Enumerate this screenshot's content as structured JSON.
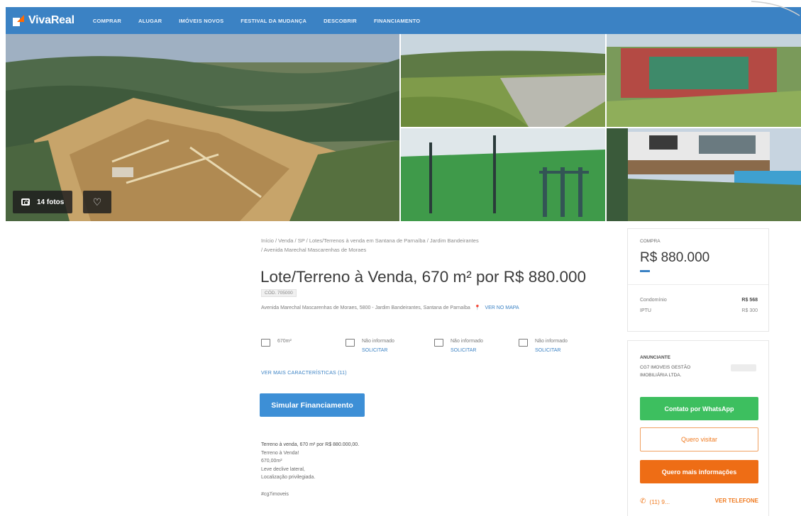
{
  "header": {
    "brand": "VivaReal",
    "nav": [
      "COMPRAR",
      "ALUGAR",
      "IMÓVEIS NOVOS",
      "FESTIVAL DA MUDANÇA",
      "DESCOBRIR",
      "FINANCIAMENTO"
    ]
  },
  "gallery": {
    "photos_label": "14 fotos",
    "camera_icon": "camera-icon",
    "favorite_icon": "heart-icon"
  },
  "listing": {
    "breadcrumb_line1": "Início / Venda / SP / Lotes/Terrenos à venda em Santana de Parnaíba / Jardim Bandeirantes",
    "breadcrumb_line2": "/ Avenida Marechal Mascarenhas de Moraes",
    "title": "Lote/Terreno à Venda, 670 m² por R$ 880.000",
    "code": "CÓD. 705000",
    "address": "Avenida Marechal Mascarenhas de Moraes, 5800 - Jardim Bandeirantes, Santana de Parnaíba",
    "map_link": "VER NO MAPA",
    "features": [
      {
        "icon": "area-icon",
        "label": "670m²",
        "request": ""
      },
      {
        "icon": "bed-icon",
        "label": "Não informado",
        "request": "SOLICITAR"
      },
      {
        "icon": "bath-icon",
        "label": "Não informado",
        "request": "SOLICITAR"
      },
      {
        "icon": "car-icon",
        "label": "Não informado",
        "request": "SOLICITAR"
      }
    ],
    "more_features": "VER MAIS CARACTERÍSTICAS (11)",
    "simulate_button": "Simular Financiamento",
    "description": [
      "Terreno à venda, 670 m² por R$ 880.000,00.",
      "Terreno à Venda!",
      "670,00m²",
      "Leve declive lateral,",
      "Localização privilegiada."
    ],
    "tag": "#cg7imoveis"
  },
  "price_card": {
    "label": "COMPRA",
    "price": "R$ 880.000",
    "condo_label": "Condomínio",
    "condo_value": "R$ 568",
    "iptu_label": "IPTU",
    "iptu_value": "R$ 300"
  },
  "contact_card": {
    "advertiser_label": "ANUNCIANTE",
    "agency": "CG7 IMOVEIS GESTÃO IMOBILIÁRIA LTDA.",
    "whatsapp_button": "Contato por WhatsApp",
    "visit_button": "Quero visitar",
    "info_button": "Quero mais informações",
    "phone_partial": "(11) 9...",
    "see_phone": "VER TELEFONE"
  },
  "colors": {
    "header": "#3b82c4",
    "primary": "#3d8fd6",
    "whatsapp": "#3dbf5f",
    "orange": "#ee6d15"
  }
}
